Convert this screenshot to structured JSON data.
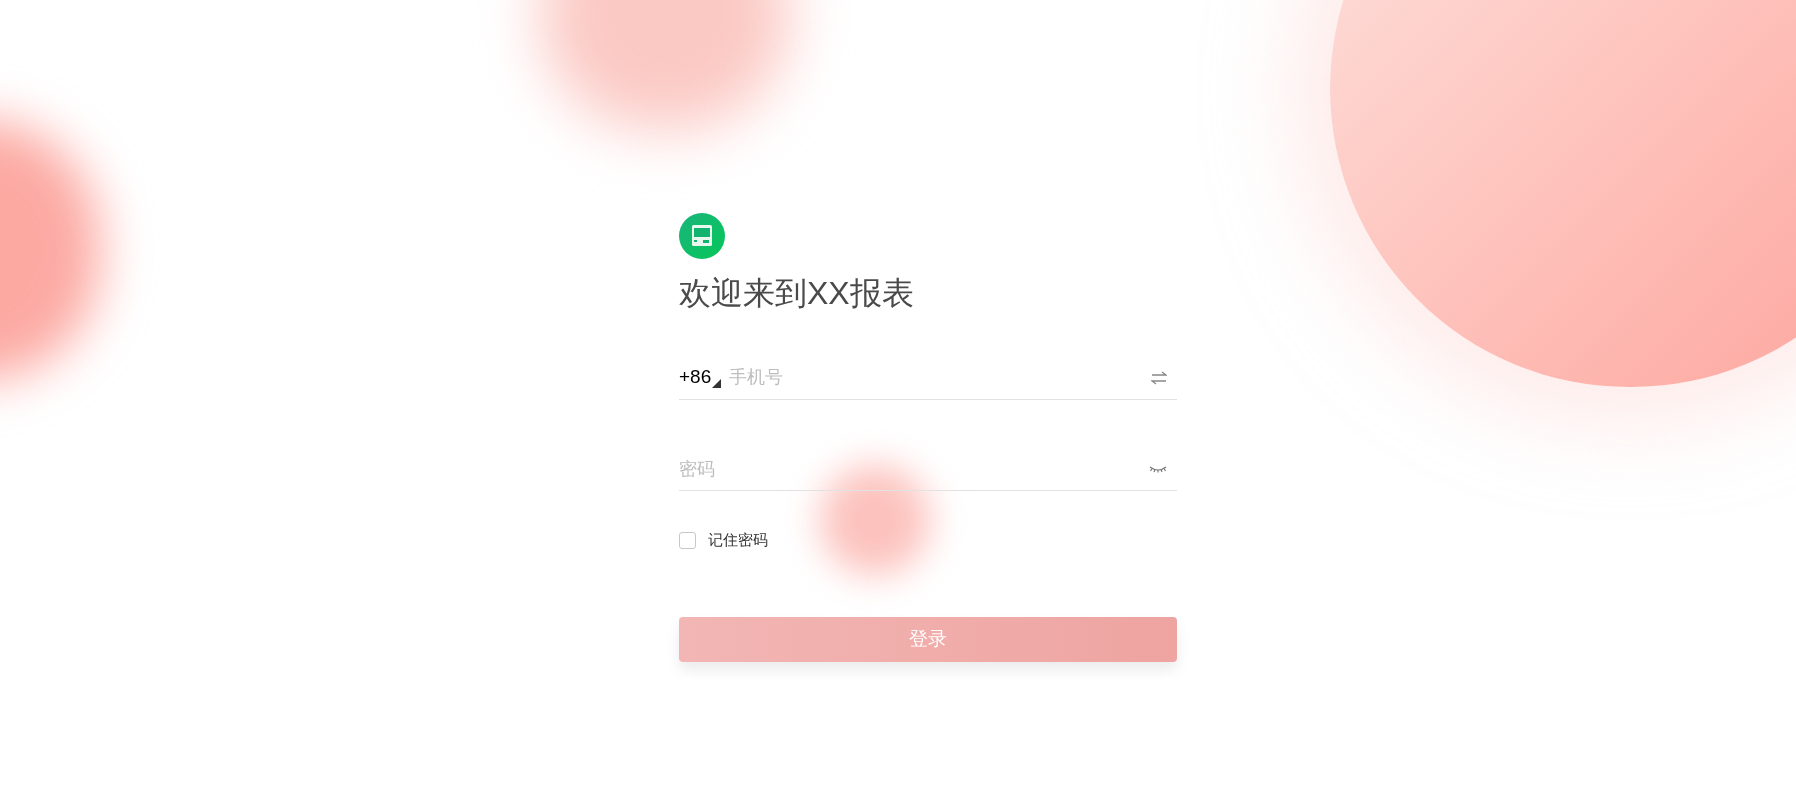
{
  "title": "欢迎来到XX报表",
  "phone_field": {
    "country_code": "+86",
    "placeholder": "手机号"
  },
  "password_field": {
    "placeholder": "密码"
  },
  "remember_password": {
    "label": "记住密码",
    "checked": false
  },
  "login_button": {
    "label": "登录"
  }
}
